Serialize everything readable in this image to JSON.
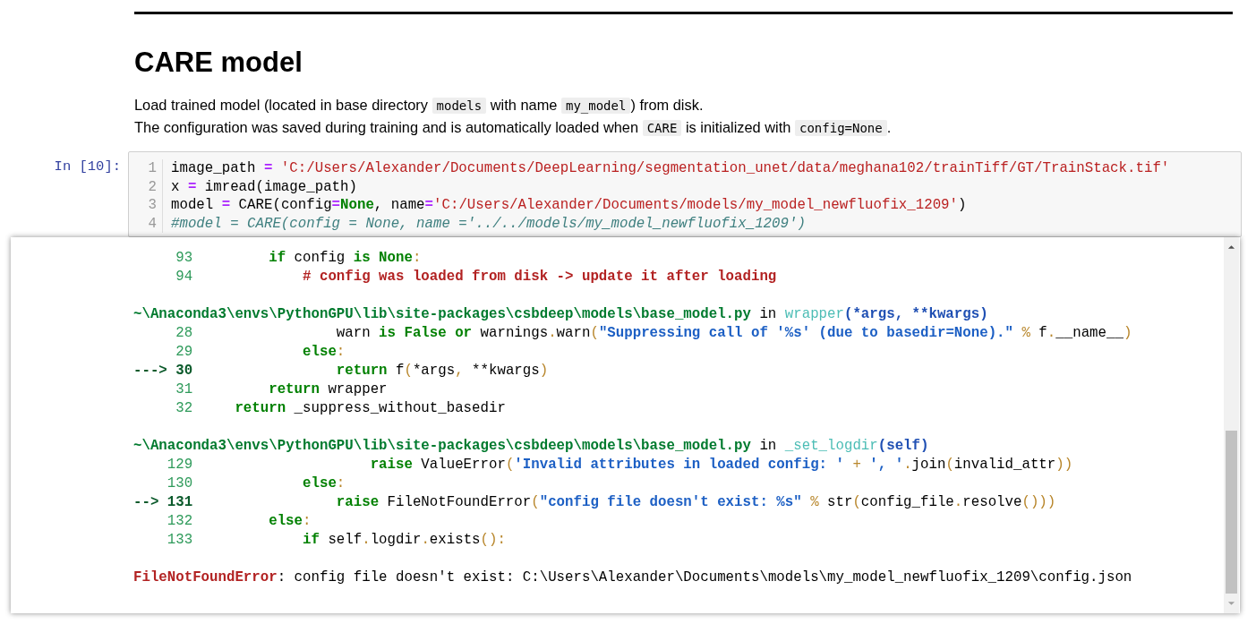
{
  "heading": "CARE model",
  "description": [
    [
      {
        "text": "Load trained model (located in base directory "
      },
      {
        "code": "models"
      },
      {
        "text": " with name "
      },
      {
        "code": "my_model"
      },
      {
        "text": ") from disk."
      }
    ],
    [
      {
        "text": "The configuration was saved during training and is automatically loaded when "
      },
      {
        "code": "CARE"
      },
      {
        "text": " is initialized with "
      },
      {
        "code": "config=None"
      },
      {
        "text": "."
      }
    ]
  ],
  "cell": {
    "prompt": "In [10]:",
    "lines": [
      {
        "number": "1",
        "tokens": [
          {
            "kind": "plain",
            "t": "image_path "
          },
          {
            "kind": "iop",
            "t": "="
          },
          {
            "kind": "istr",
            "t": " 'C:/Users/Alexander/Documents/DeepLearning/segmentation_unet/data/meghana102/trainTiff/GT/TrainStack.tif'"
          }
        ]
      },
      {
        "number": "2",
        "tokens": [
          {
            "kind": "plain",
            "t": "x "
          },
          {
            "kind": "iop",
            "t": "="
          },
          {
            "kind": "plain",
            "t": " imread(image_path)"
          }
        ]
      },
      {
        "number": "3",
        "tokens": [
          {
            "kind": "plain",
            "t": "model "
          },
          {
            "kind": "iop",
            "t": "="
          },
          {
            "kind": "plain",
            "t": " CARE(config"
          },
          {
            "kind": "iop",
            "t": "="
          },
          {
            "kind": "kw",
            "t": "None"
          },
          {
            "kind": "plain",
            "t": ", name"
          },
          {
            "kind": "iop",
            "t": "="
          },
          {
            "kind": "istr",
            "t": "'C:/Users/Alexander/Documents/models/my_model_newfluofix_1209'"
          },
          {
            "kind": "plain",
            "t": ")"
          }
        ]
      },
      {
        "number": "4",
        "tokens": [
          {
            "kind": "icom",
            "t": "#model = CARE(config = None, name ='../../models/my_model_newfluofix_1209')"
          }
        ]
      }
    ]
  },
  "output": {
    "frames": [
      {
        "lines": [
          {
            "number": "93",
            "tokens": [
              {
                "kind": "kw",
                "t": "         if"
              },
              {
                "kind": "plain",
                "t": " config "
              },
              {
                "kind": "kw",
                "t": "is"
              },
              {
                "kind": "kw",
                "t": " None"
              },
              {
                "kind": "op",
                "t": ":"
              }
            ]
          },
          {
            "number": "94",
            "tokens": [
              {
                "kind": "com",
                "t": "             # config was loaded from disk -> update it after loading"
              }
            ]
          }
        ]
      },
      {
        "header": [
          {
            "kind": "path",
            "t": "~\\Anaconda3\\envs\\PythonGPU\\lib\\site-packages\\csbdeep\\models\\base_model.py"
          },
          {
            "kind": "plain",
            "t": " in "
          },
          {
            "kind": "func",
            "t": "wrapper"
          },
          {
            "kind": "sig",
            "t": "(*args, **kwargs)"
          }
        ],
        "lines": [
          {
            "number": "28",
            "tokens": [
              {
                "kind": "plain",
                "t": "                 warn "
              },
              {
                "kind": "kw",
                "t": "is"
              },
              {
                "kind": "kw",
                "t": " False"
              },
              {
                "kind": "kw",
                "t": " or"
              },
              {
                "kind": "plain",
                "t": " warnings"
              },
              {
                "kind": "op",
                "t": "."
              },
              {
                "kind": "plain",
                "t": "warn"
              },
              {
                "kind": "op",
                "t": "("
              },
              {
                "kind": "str",
                "t": "\"Suppressing call of '%s' (due to basedir=None).\""
              },
              {
                "kind": "op",
                "t": " %"
              },
              {
                "kind": "plain",
                "t": " f"
              },
              {
                "kind": "op",
                "t": "."
              },
              {
                "kind": "plain",
                "t": "__name__"
              },
              {
                "kind": "op",
                "t": ")"
              }
            ]
          },
          {
            "number": "29",
            "tokens": [
              {
                "kind": "kw",
                "t": "             else"
              },
              {
                "kind": "op",
                "t": ":"
              }
            ]
          },
          {
            "marker": "--->",
            "number": "30",
            "tokens": [
              {
                "kind": "kw",
                "t": "                 return"
              },
              {
                "kind": "plain",
                "t": " f"
              },
              {
                "kind": "op",
                "t": "("
              },
              {
                "kind": "plain",
                "t": "*args"
              },
              {
                "kind": "op",
                "t": ","
              },
              {
                "kind": "plain",
                "t": " **kwargs"
              },
              {
                "kind": "op",
                "t": ")"
              }
            ]
          },
          {
            "number": "31",
            "tokens": [
              {
                "kind": "kw",
                "t": "         return"
              },
              {
                "kind": "plain",
                "t": " wrapper"
              }
            ]
          },
          {
            "number": "32",
            "tokens": [
              {
                "kind": "kw",
                "t": "     return"
              },
              {
                "kind": "plain",
                "t": " _suppress_without_basedir"
              }
            ]
          }
        ]
      },
      {
        "header": [
          {
            "kind": "path",
            "t": "~\\Anaconda3\\envs\\PythonGPU\\lib\\site-packages\\csbdeep\\models\\base_model.py"
          },
          {
            "kind": "plain",
            "t": " in "
          },
          {
            "kind": "func",
            "t": "_set_logdir"
          },
          {
            "kind": "sig",
            "t": "(self)"
          }
        ],
        "lines": [
          {
            "number": "129",
            "tokens": [
              {
                "kind": "kw",
                "t": "                     raise"
              },
              {
                "kind": "plain",
                "t": " ValueError"
              },
              {
                "kind": "op",
                "t": "("
              },
              {
                "kind": "str",
                "t": "'Invalid attributes in loaded config: '"
              },
              {
                "kind": "op",
                "t": " +"
              },
              {
                "kind": "str",
                "t": " ', '"
              },
              {
                "kind": "op",
                "t": "."
              },
              {
                "kind": "plain",
                "t": "join"
              },
              {
                "kind": "op",
                "t": "("
              },
              {
                "kind": "plain",
                "t": "invalid_attr"
              },
              {
                "kind": "op",
                "t": "))"
              }
            ]
          },
          {
            "number": "130",
            "tokens": [
              {
                "kind": "kw",
                "t": "             else"
              },
              {
                "kind": "op",
                "t": ":"
              }
            ]
          },
          {
            "marker": "-->",
            "number": "131",
            "tokens": [
              {
                "kind": "kw",
                "t": "                 raise"
              },
              {
                "kind": "plain",
                "t": " FileNotFoundError"
              },
              {
                "kind": "op",
                "t": "("
              },
              {
                "kind": "str",
                "t": "\"config file doesn't exist: %s\""
              },
              {
                "kind": "op",
                "t": " %"
              },
              {
                "kind": "plain",
                "t": " str"
              },
              {
                "kind": "op",
                "t": "("
              },
              {
                "kind": "plain",
                "t": "config_file"
              },
              {
                "kind": "op",
                "t": "."
              },
              {
                "kind": "plain",
                "t": "resolve"
              },
              {
                "kind": "op",
                "t": "()))"
              }
            ]
          },
          {
            "number": "132",
            "tokens": [
              {
                "kind": "kw",
                "t": "         else"
              },
              {
                "kind": "op",
                "t": ":"
              }
            ]
          },
          {
            "number": "133",
            "tokens": [
              {
                "kind": "kw",
                "t": "             if"
              },
              {
                "kind": "plain",
                "t": " self"
              },
              {
                "kind": "op",
                "t": "."
              },
              {
                "kind": "plain",
                "t": "logdir"
              },
              {
                "kind": "op",
                "t": "."
              },
              {
                "kind": "plain",
                "t": "exists"
              },
              {
                "kind": "op",
                "t": "():"
              }
            ]
          }
        ]
      }
    ],
    "error": [
      {
        "kind": "err",
        "t": "FileNotFoundError"
      },
      {
        "kind": "plain",
        "t": ": config file doesn't exist: C:\\Users\\Alexander\\Documents\\models\\my_model_newfluofix_1209\\config.json"
      }
    ]
  }
}
